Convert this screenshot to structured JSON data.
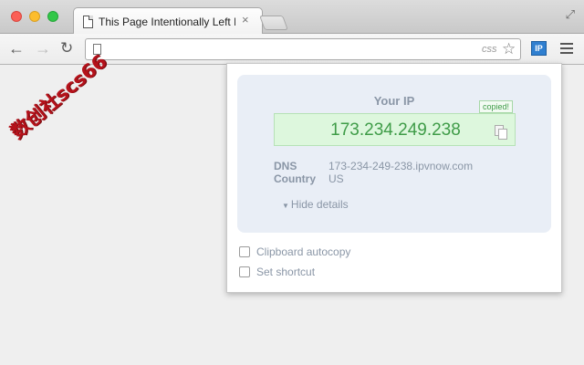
{
  "tab": {
    "title": "This Page Intentionally Left B",
    "close": "×"
  },
  "toolbar": {
    "back": "←",
    "forward": "→",
    "reload": "↻",
    "omnibox_badge": "css",
    "star": "☆",
    "extension_label": "IP"
  },
  "watermark": "数创社scs66",
  "popup": {
    "your_ip_label": "Your IP",
    "ip_value": "173.234.249.238",
    "copied_badge": "copied!",
    "details": [
      {
        "key": "DNS",
        "value": "173-234-249-238.ipvnow.com"
      },
      {
        "key": "Country",
        "value": "US"
      }
    ],
    "hide_details_chevron": "▼",
    "hide_details_label": "Hide details",
    "options": [
      {
        "label": "Clipboard autocopy",
        "checked": false
      },
      {
        "label": "Set shortcut",
        "checked": false
      }
    ]
  },
  "colors": {
    "ip_green": "#3f9c48",
    "card_bg": "#e9eef6",
    "ip_box_bg": "#ddf7dd",
    "extension_blue": "#2f7fd0"
  }
}
